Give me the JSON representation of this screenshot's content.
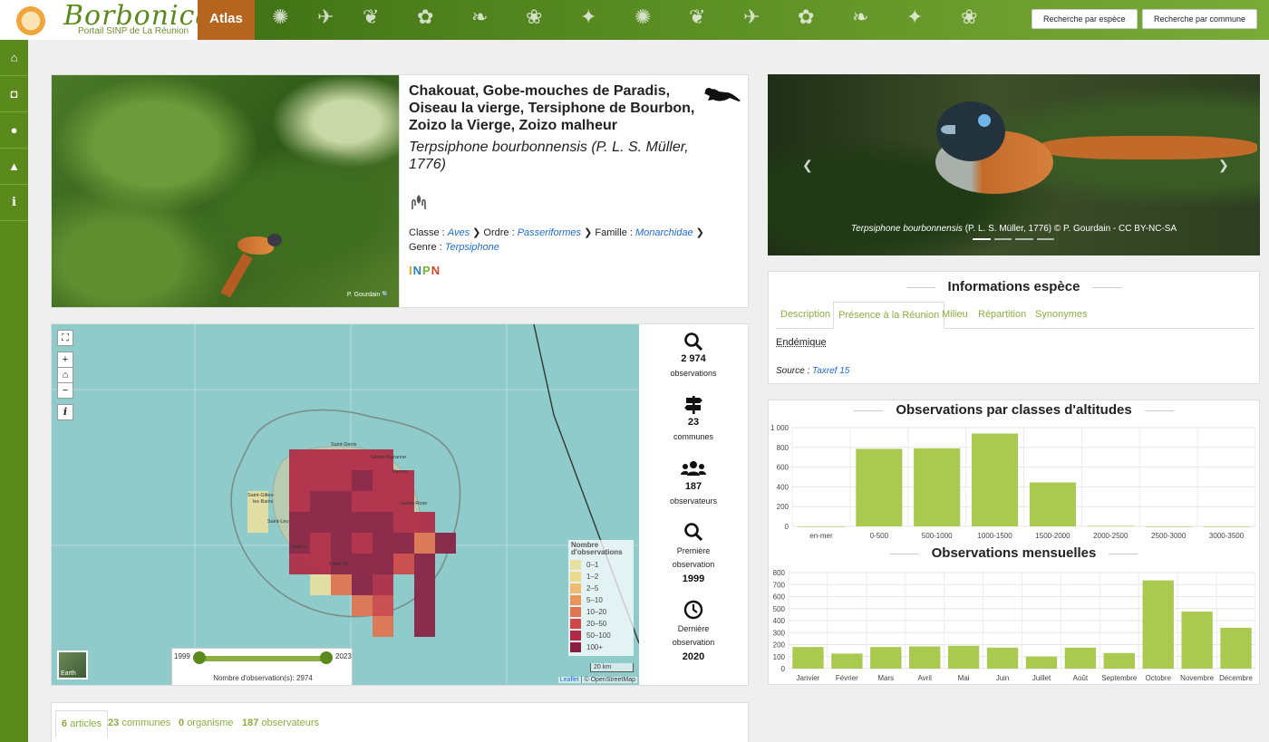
{
  "header": {
    "logo_text": "Borbonica",
    "logo_subtitle": "Portail SINP de La Réunion",
    "atlas_label": "Atlas",
    "search_species_label": "Recherche par espèce",
    "search_commune_label": "Recherche par commune"
  },
  "sidebar": {
    "items": [
      {
        "icon": "home-icon",
        "glyph": "⌂"
      },
      {
        "icon": "camera-icon",
        "glyph": "◘"
      },
      {
        "icon": "user-icon",
        "glyph": "●"
      },
      {
        "icon": "graduation-cap-icon",
        "glyph": "▲"
      },
      {
        "icon": "info-icon",
        "glyph": "i"
      }
    ]
  },
  "species": {
    "common_names": "Chakouat, Gobe-mouches de Paradis, Oiseau la vierge, Tersiphone de Bourbon, Zoizo la Vierge, Zoizo malheur",
    "scientific_name": "Terpsiphone bourbonnensis (P. L. S. Müller, 1776)",
    "photo_credit": "P. Gourdain",
    "classe_label": "Classe :",
    "classe": "Aves",
    "ordre_label": "Ordre :",
    "ordre": "Passeriformes",
    "famille_label": "Famille :",
    "famille": "Monarchidae",
    "genre_label": "Genre :",
    "genre": "Terpsiphone",
    "inpn_label": "INPN"
  },
  "map": {
    "slider_start": "1999",
    "slider_end": "2023",
    "slider_caption": "Nombre d'observation(s): 2974",
    "legend_title": "Nombre d'observations",
    "legend": [
      {
        "label": "0–1",
        "color": "#e8e0a0"
      },
      {
        "label": "1–2",
        "color": "#eed88a"
      },
      {
        "label": "2–5",
        "color": "#eebb70"
      },
      {
        "label": "5–10",
        "color": "#e8955a"
      },
      {
        "label": "10–20",
        "color": "#e2734f"
      },
      {
        "label": "20–50",
        "color": "#cf4746"
      },
      {
        "label": "50–100",
        "color": "#b12a45"
      },
      {
        "label": "100+",
        "color": "#8a1f42"
      }
    ],
    "scale_label": "20 km",
    "attribution_leaflet": "Leaflet",
    "attribution_rest": " | © OpenStreetMap",
    "earth_label": "Earth",
    "places": [
      "Saint-Denis",
      "Sainte-Suzanne",
      "Saint-Gilles-les-Bains",
      "Saint-Leu",
      "Saint-André",
      "Sainte-Rose",
      "Saint-Louis",
      "Petite-Île"
    ]
  },
  "stats": {
    "observations_num": "2 974",
    "observations_label": "observations",
    "communes_num": "23",
    "communes_label": "communes",
    "observateurs_num": "187",
    "observateurs_label": "observateurs",
    "first_label": "Première observation",
    "first_year": "1999",
    "last_label": "Dernière observation",
    "last_year": "2020"
  },
  "bottom_tabs": [
    {
      "count": "6",
      "label": "articles"
    },
    {
      "count": "23",
      "label": "communes"
    },
    {
      "count": "0",
      "label": "organisme"
    },
    {
      "count": "187",
      "label": "observateurs"
    }
  ],
  "carousel": {
    "caption_sci": "Terpsiphone bourbonnensis",
    "caption_rest": " (P. L. S. Müller, 1776) © P. Gourdain - CC BY-NC-SA"
  },
  "info": {
    "title": "Informations espèce",
    "tabs": [
      "Description",
      "Présence à la Réunion",
      "Milieu",
      "Répartition",
      "Synonymes"
    ],
    "status": "Endémique",
    "source_label": "Source :",
    "source_value": "Taxref 15"
  },
  "chart_data": [
    {
      "type": "bar",
      "title": "Observations par classes d'altitudes",
      "categories": [
        "en-mer",
        "0-500",
        "500-1000",
        "1000-1500",
        "1500-2000",
        "2000-2500",
        "2500-3000",
        "3000-3500"
      ],
      "values": [
        0,
        785,
        790,
        940,
        445,
        5,
        0,
        0
      ],
      "ylim": [
        0,
        1000
      ],
      "yticks": [
        0,
        200,
        400,
        600,
        800,
        1000
      ],
      "color": "#a9c94f"
    },
    {
      "type": "bar",
      "title": "Observations mensuelles",
      "categories": [
        "Janvier",
        "Février",
        "Mars",
        "Avril",
        "Mai",
        "Juin",
        "Juillet",
        "Août",
        "Septembre",
        "Octobre",
        "Novembre",
        "Décembre"
      ],
      "values": [
        180,
        125,
        180,
        185,
        190,
        175,
        100,
        175,
        130,
        735,
        475,
        340
      ],
      "ylim": [
        0,
        800
      ],
      "yticks": [
        0,
        100,
        200,
        300,
        400,
        500,
        600,
        700,
        800
      ],
      "color": "#a9c94f"
    }
  ]
}
